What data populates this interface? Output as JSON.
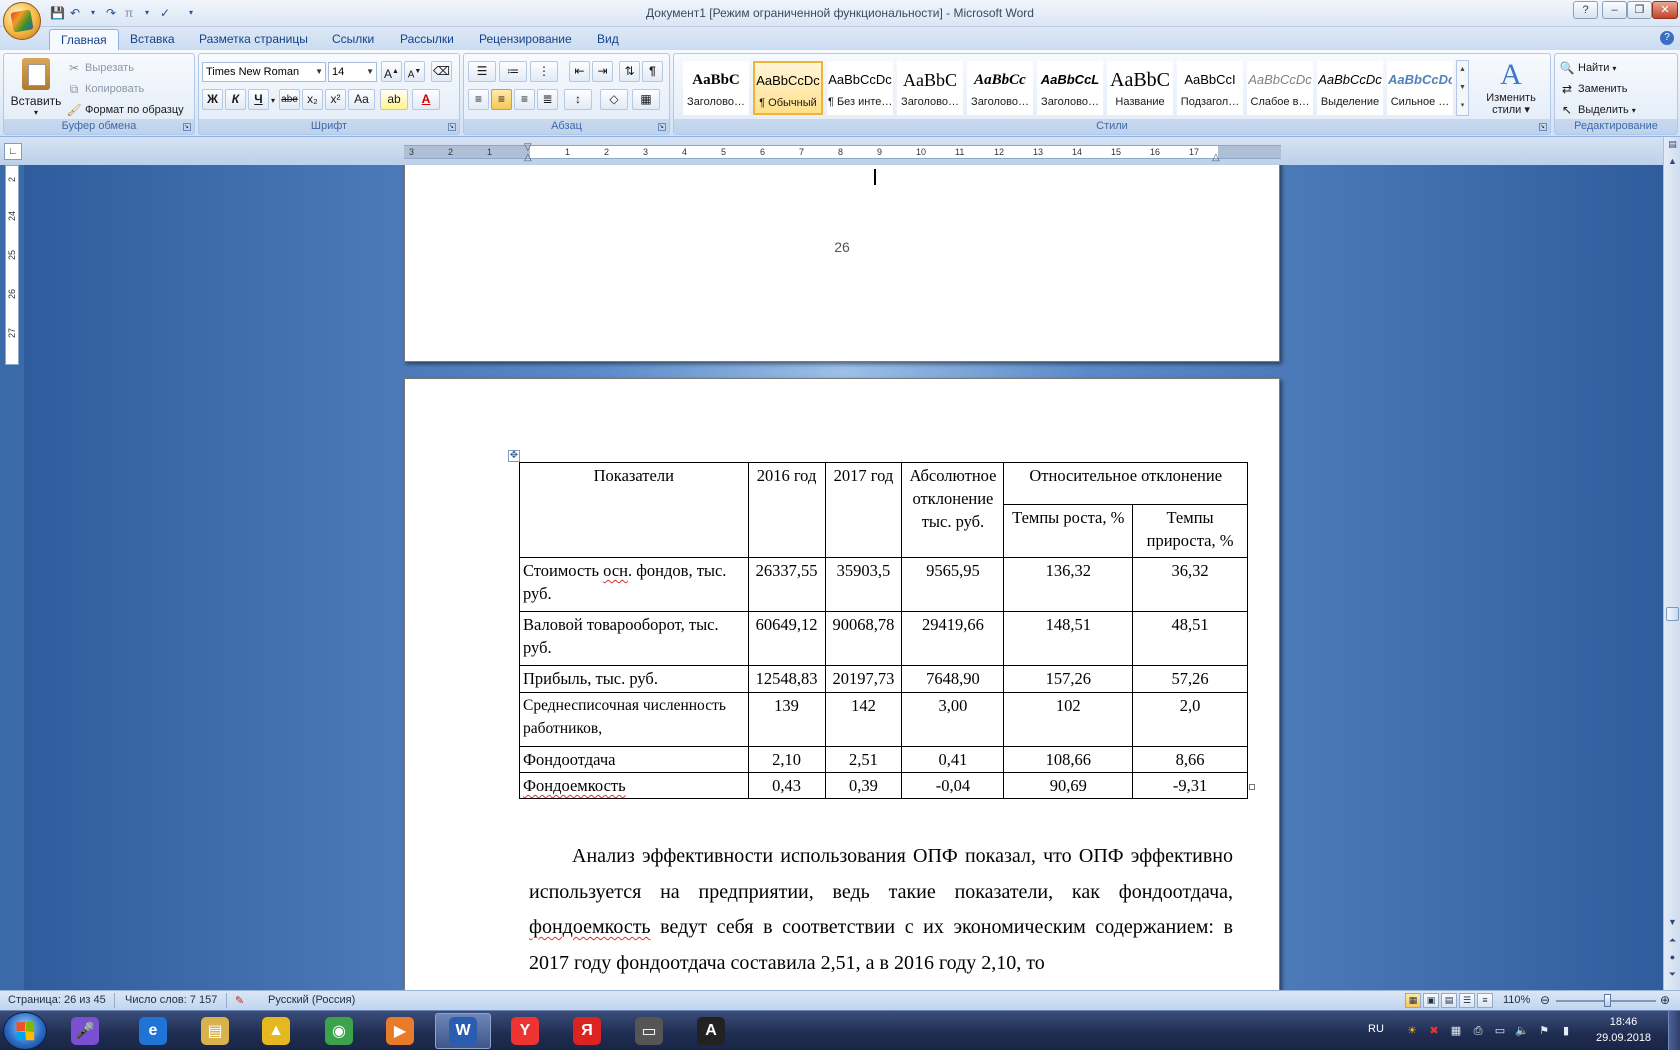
{
  "window": {
    "title": "Документ1 [Режим ограниченной функциональности] - Microsoft Word",
    "controls": {
      "help": "?",
      "minimize": "–",
      "maximize": "❐",
      "close": "✕"
    }
  },
  "ribbon_tabs": [
    "Главная",
    "Вставка",
    "Разметка страницы",
    "Ссылки",
    "Рассылки",
    "Рецензирование",
    "Вид"
  ],
  "clipboard": {
    "paste": "Вставить",
    "cut": "Вырезать",
    "copy": "Копировать",
    "format_painter": "Формат по образцу",
    "label": "Буфер обмена"
  },
  "font": {
    "name": "Times New Roman",
    "size": "14",
    "grow": "A",
    "shrink": "A",
    "bold": "Ж",
    "italic": "К",
    "underline": "Ч",
    "strike": "abe",
    "subscript": "x₂",
    "superscript": "x²",
    "case": "Aa",
    "label": "Шрифт"
  },
  "paragraph": {
    "label": "Абзац",
    "pilcrow": "¶"
  },
  "styles": {
    "label": "Стили",
    "items": [
      {
        "preview": "AaBbC",
        "name": "Заголово…"
      },
      {
        "preview": "AaBbCcDc",
        "name": "¶ Обычный"
      },
      {
        "preview": "AaBbCcDc",
        "name": "¶ Без инте…"
      },
      {
        "preview": "AaBbC",
        "name": "Заголово…"
      },
      {
        "preview": "AaBbCc",
        "name": "Заголово…"
      },
      {
        "preview": "AaBbCcL",
        "name": "Заголово…"
      },
      {
        "preview": "AaBbC",
        "name": "Название"
      },
      {
        "preview": "AaBbCcI",
        "name": "Подзагол…"
      },
      {
        "preview": "AaBbCcDc",
        "name": "Слабое в…"
      },
      {
        "preview": "AaBbCcDc",
        "name": "Выделение"
      },
      {
        "preview": "AaBbCcDc",
        "name": "Сильное …"
      }
    ],
    "change_styles_line1": "Изменить",
    "change_styles_line2": "стили"
  },
  "editing": {
    "label": "Редактирование",
    "find": "Найти",
    "replace": "Заменить",
    "select": "Выделить"
  },
  "ruler": {
    "h_labels": [
      "3",
      "2",
      "1",
      "1",
      "2",
      "3",
      "4",
      "5",
      "6",
      "7",
      "8",
      "9",
      "10",
      "11",
      "12",
      "13",
      "14",
      "15",
      "16",
      "17"
    ],
    "v_labels": [
      "2",
      "24",
      "25",
      "26",
      "27"
    ]
  },
  "document": {
    "page_number": "26",
    "table": {
      "header": {
        "col1": "Показатели",
        "col2": "2016 год",
        "col3": "2017 год",
        "col4": "Абсолютное отклонение тыс. руб.",
        "col5_group": "Относительное отклонение",
        "col5a": "Темпы роста, %",
        "col5b": "Темпы прироста, %"
      },
      "rows": [
        {
          "label_pre": "Стоимость ",
          "label_err": "осн",
          "label_post": ". фондов, тыс. руб.",
          "v2016": "26337,55",
          "v2017": "35903,5",
          "abs": "9565,95",
          "growth": "136,32",
          "increase": "36,32"
        },
        {
          "label_pre": "Валовой товарооборот, тыс. руб.",
          "label_err": "",
          "label_post": "",
          "v2016": "60649,12",
          "v2017": "90068,78",
          "abs": "29419,66",
          "growth": "148,51",
          "increase": "48,51"
        },
        {
          "label_pre": "Прибыль, тыс. руб.",
          "label_err": "",
          "label_post": "",
          "v2016": "12548,83",
          "v2017": "20197,73",
          "abs": "7648,90",
          "growth": "157,26",
          "increase": "57,26"
        },
        {
          "label_pre": "Среднесписочная численность работников,",
          "label_err": "",
          "label_post": "",
          "v2016": "139",
          "v2017": "142",
          "abs": "3,00",
          "growth": "102",
          "increase": "2,0"
        },
        {
          "label_pre": "Фондоотдача",
          "label_err": "",
          "label_post": "",
          "v2016": "2,10",
          "v2017": "2,51",
          "abs": "0,41",
          "growth": "108,66",
          "increase": "8,66"
        },
        {
          "label_pre": "",
          "label_err": "Фондоемкость",
          "label_post": "",
          "v2016": "0,43",
          "v2017": "0,39",
          "abs": "-0,04",
          "growth": "90,69",
          "increase": "-9,31"
        }
      ]
    },
    "paragraph": {
      "part1": "Анализ эффективности использования ОПФ показал, что ОПФ эффективно используется на предприятии, ведь такие показатели, как фондоотдача, ",
      "err": "фондоемкость",
      "part2": " ведут себя в соответствии с их экономическим содержанием: в 2017 году фондоотдача составила 2,51, а в 2016 году 2,10, то"
    }
  },
  "statusbar": {
    "page": "Страница: 26 из 45",
    "words": "Число слов: 7 157",
    "language": "Русский (Россия)",
    "zoom": "110%",
    "zoom_level_pct": 110
  },
  "taskbar": {
    "apps": [
      {
        "name": "Microphone",
        "glyph": "🎤",
        "color": "#7b4fd1"
      },
      {
        "name": "Internet Explorer",
        "glyph": "e",
        "color": "#1f74d6"
      },
      {
        "name": "Explorer",
        "glyph": "▤",
        "color": "#d9b24c"
      },
      {
        "name": "Archiver",
        "glyph": "▲",
        "color": "#e6b820"
      },
      {
        "name": "Chrome",
        "glyph": "◉",
        "color": "#3ca24b"
      },
      {
        "name": "Media",
        "glyph": "▶",
        "color": "#e87b2a"
      },
      {
        "name": "Word",
        "glyph": "W",
        "color": "#2a5db0"
      },
      {
        "name": "Yandex",
        "glyph": "Y",
        "color": "#e33"
      },
      {
        "name": "Yandex Browser",
        "glyph": "Я",
        "color": "#d22"
      },
      {
        "name": "Scanner",
        "glyph": "▭",
        "color": "#555"
      },
      {
        "name": "Font Viewer",
        "glyph": "A",
        "color": "#222"
      }
    ],
    "tray_lang": "RU",
    "time": "18:46",
    "date": "29.09.2018"
  }
}
